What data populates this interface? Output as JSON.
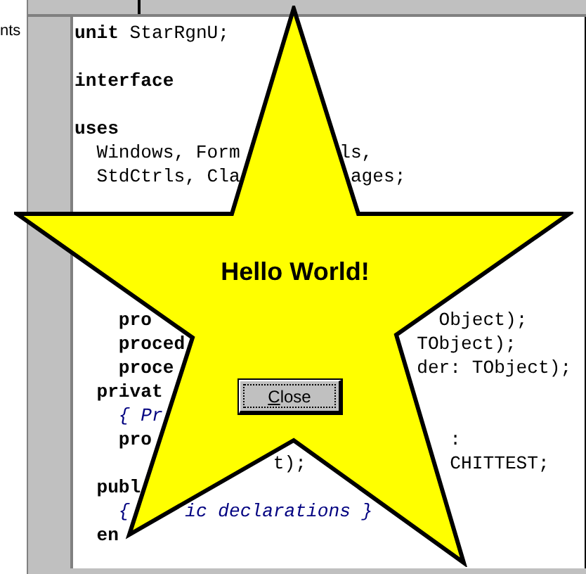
{
  "side_panel": {
    "label": "nts"
  },
  "editor": {
    "lines": [
      {
        "kind": "code",
        "segments": [
          {
            "kind": "keyword",
            "text": "unit"
          },
          {
            "kind": "plain",
            "text": " StarRgnU;"
          }
        ]
      },
      {
        "kind": "blank"
      },
      {
        "kind": "code",
        "segments": [
          {
            "kind": "keyword",
            "text": "interface"
          }
        ]
      },
      {
        "kind": "blank"
      },
      {
        "kind": "code",
        "segments": [
          {
            "kind": "keyword",
            "text": "uses"
          }
        ]
      },
      {
        "kind": "code",
        "segments": [
          {
            "kind": "plain",
            "text": "  Windows, Form"
          },
          {
            "kind": "plain",
            "text": "         ls,"
          }
        ]
      },
      {
        "kind": "code",
        "segments": [
          {
            "kind": "plain",
            "text": "  StdCtrls, Cla"
          },
          {
            "kind": "plain",
            "text": "          ages;"
          }
        ]
      },
      {
        "kind": "blank"
      },
      {
        "kind": "blank"
      },
      {
        "kind": "blank"
      },
      {
        "kind": "blank"
      },
      {
        "kind": "blank"
      },
      {
        "kind": "code",
        "segments": [
          {
            "kind": "keyword",
            "text": "    pro"
          },
          {
            "kind": "plain",
            "text": "                          Object);"
          }
        ]
      },
      {
        "kind": "code",
        "segments": [
          {
            "kind": "keyword",
            "text": "    proced"
          },
          {
            "kind": "plain",
            "text": "                     TObject);"
          }
        ]
      },
      {
        "kind": "code",
        "segments": [
          {
            "kind": "keyword",
            "text": "    proce"
          },
          {
            "kind": "plain",
            "text": "                      der: TObject);"
          }
        ]
      },
      {
        "kind": "code",
        "segments": [
          {
            "kind": "keyword",
            "text": "  privat"
          }
        ]
      },
      {
        "kind": "code",
        "segments": [
          {
            "kind": "comment",
            "text": "    { Pr"
          }
        ]
      },
      {
        "kind": "code",
        "segments": [
          {
            "kind": "keyword",
            "text": "    pro"
          },
          {
            "kind": "plain",
            "text": "                           :"
          }
        ]
      },
      {
        "kind": "code",
        "segments": [
          {
            "kind": "plain",
            "text": "                  t);"
          },
          {
            "kind": "plain",
            "text": "             CHITTEST;"
          }
        ]
      },
      {
        "kind": "code",
        "segments": [
          {
            "kind": "keyword",
            "text": "  publ"
          }
        ]
      },
      {
        "kind": "code",
        "segments": [
          {
            "kind": "comment",
            "text": "    {"
          },
          {
            "kind": "comment",
            "text": "     ic declarations }"
          }
        ]
      },
      {
        "kind": "code",
        "segments": [
          {
            "kind": "keyword",
            "text": "  en"
          }
        ]
      }
    ]
  },
  "star_window": {
    "message": "Hello World!",
    "button": {
      "label": "Close",
      "focused": true
    }
  }
}
